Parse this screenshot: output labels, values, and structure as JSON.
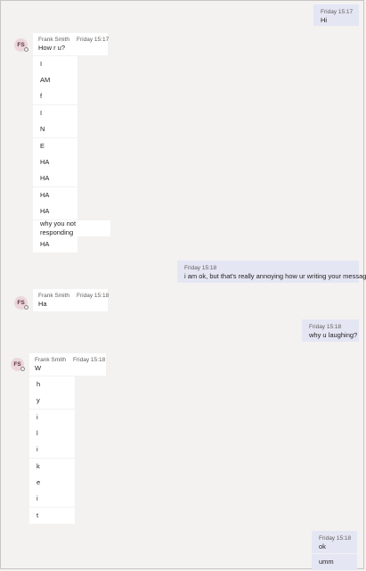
{
  "messages": {
    "m1": {
      "time": "Friday 15:17",
      "text": "Hi"
    },
    "m2": {
      "avatar_initials": "FS",
      "sender": "Frank Smith",
      "time": "Friday 15:17",
      "text": "How r u?",
      "continuations": [
        "I",
        "AM",
        "f",
        "I",
        "N",
        "E",
        "HA",
        "HA",
        "HA",
        "HA",
        "why you not responding",
        "HA"
      ]
    },
    "m3": {
      "time": "Friday 15:18",
      "text": "i am ok, but that's really annoying how ur writing your message"
    },
    "m4": {
      "avatar_initials": "FS",
      "sender": "Frank Smith",
      "time": "Friday 15:18",
      "text": "Ha"
    },
    "m5": {
      "time": "Friday 15:18",
      "text": "why u laughing?"
    },
    "m6": {
      "avatar_initials": "FS",
      "sender": "Frank Smith",
      "time": "Friday 15:18",
      "text": "W",
      "continuations": [
        "h",
        "y",
        "i",
        "l",
        "i",
        "k",
        "e",
        "i",
        "t"
      ]
    },
    "m7": {
      "time": "Friday 15:18",
      "text": "ok",
      "continuation": "umm"
    }
  },
  "colors": {
    "background": "#f3f2f1",
    "incoming_bubble": "#ffffff",
    "outgoing_bubble": "#e5e6f4",
    "avatar_bg": "#ecd6dc"
  }
}
